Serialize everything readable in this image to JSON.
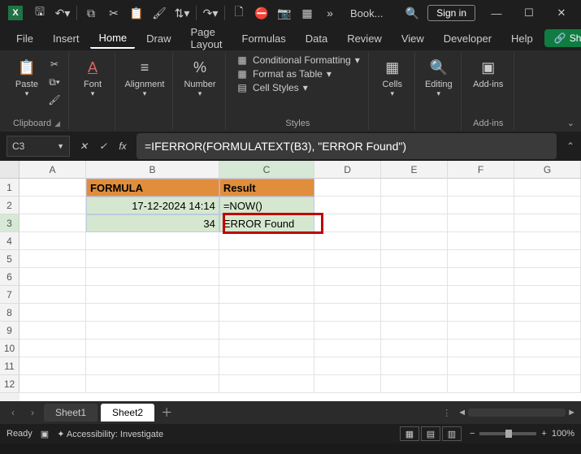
{
  "title_doc": "Book...",
  "signin": "Sign in",
  "menu": {
    "file": "File",
    "insert": "Insert",
    "home": "Home",
    "draw": "Draw",
    "pagelayout": "Page Layout",
    "formulas": "Formulas",
    "data": "Data",
    "review": "Review",
    "view": "View",
    "developer": "Developer",
    "help": "Help",
    "share": "Share"
  },
  "ribbon": {
    "clipboard": {
      "label": "Clipboard",
      "paste": "Paste"
    },
    "font": {
      "label": "Font",
      "btn": "Font"
    },
    "alignment": {
      "btn": "Alignment"
    },
    "number": {
      "btn": "Number"
    },
    "styles": {
      "label": "Styles",
      "cond": "Conditional Formatting",
      "table": "Format as Table",
      "cell": "Cell Styles"
    },
    "cells": {
      "btn": "Cells"
    },
    "editing": {
      "btn": "Editing"
    },
    "addins": {
      "label": "Add-ins",
      "btn": "Add-ins"
    }
  },
  "namebox": "C3",
  "formula": "=IFERROR(FORMULATEXT(B3), \"ERROR Found\")",
  "cols": [
    "A",
    "B",
    "C",
    "D",
    "E",
    "F",
    "G"
  ],
  "rows": [
    "1",
    "2",
    "3",
    "4",
    "5",
    "6",
    "7",
    "8",
    "9",
    "10",
    "11",
    "12"
  ],
  "cells": {
    "B1": "FORMULA",
    "C1": "Result",
    "B2": "17-12-2024 14:14",
    "C2": "=NOW()",
    "B3": "34",
    "C3": "ERROR Found"
  },
  "tabs": {
    "s1": "Sheet1",
    "s2": "Sheet2"
  },
  "status": {
    "ready": "Ready",
    "acc": "Accessibility: Investigate",
    "zoom": "100%"
  }
}
